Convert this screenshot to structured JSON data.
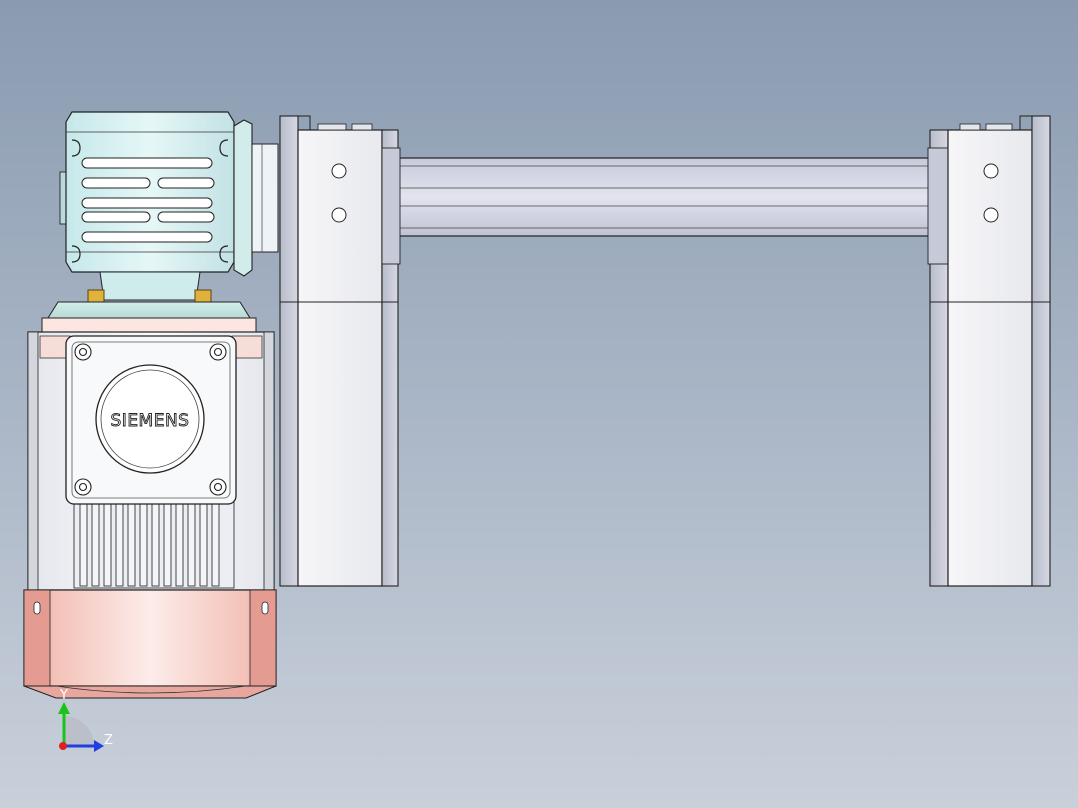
{
  "viewport": {
    "background_top": "#8a9bb0",
    "background_bottom": "#c9d0da"
  },
  "motor": {
    "brand": "SIEMENS",
    "gearbox_color": "#d9f2f2",
    "fan_cover_color": "#f0b8ae",
    "bolt_color": "#e0b23c"
  },
  "triad": {
    "y_label": "Y",
    "z_label": "Z"
  }
}
